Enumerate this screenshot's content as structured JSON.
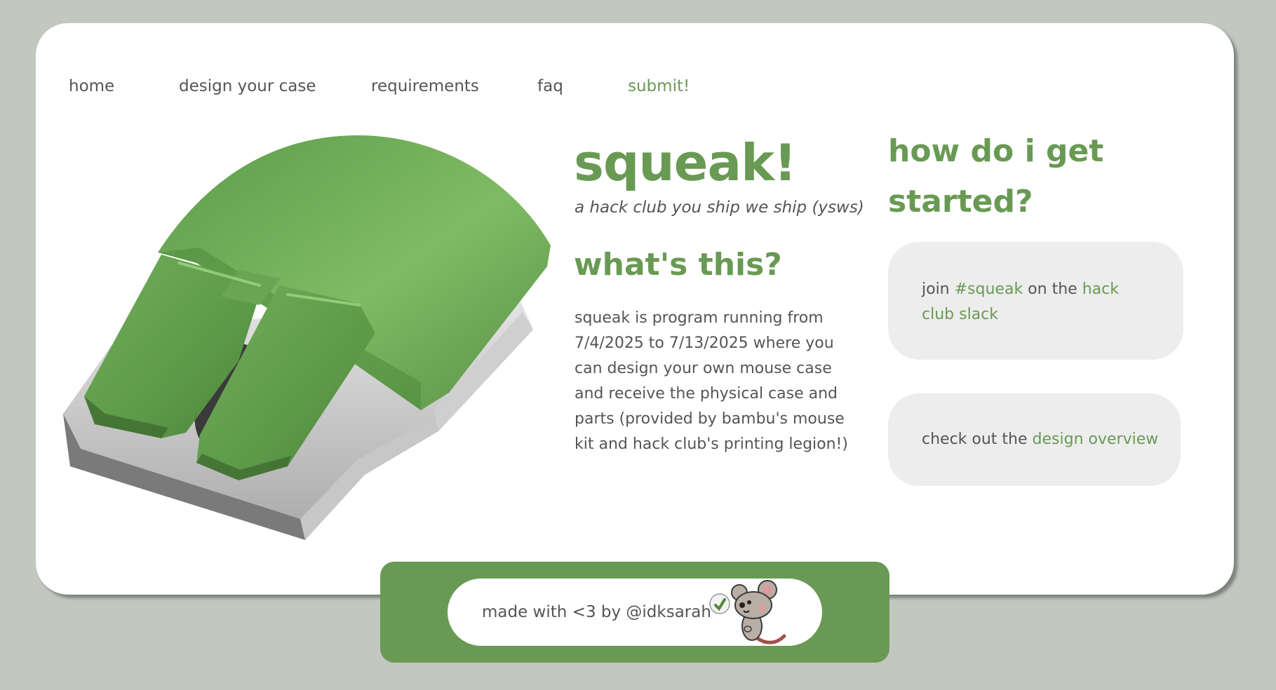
{
  "nav": {
    "home": "home",
    "design": "design your case",
    "requirements": "requirements",
    "faq": "faq",
    "submit": "submit!"
  },
  "hero": {
    "title": "squeak!",
    "subtitle": "a hack club you ship we ship (ysws)"
  },
  "about": {
    "heading": "what's this?",
    "body": "squeak is program running from 7/4/2025 to 7/13/2025 where you can design your own mouse case and receive the physical case and parts (provided by bambu's mouse kit and hack club's printing legion!)"
  },
  "started": {
    "heading": "how do i get started?",
    "step1": {
      "prefix": "join ",
      "channel": "#squeak",
      "middle": " on the ",
      "link": "hack club slack"
    },
    "step2": {
      "prefix": "check out the ",
      "link": "design overview"
    }
  },
  "footer": {
    "text": "made with <3 by @idksarah"
  },
  "colors": {
    "accent": "#699a53",
    "background": "#c2c8c0",
    "text": "#555555",
    "box": "#ededed"
  },
  "icons": {
    "hero_image": "mouse-case-render",
    "mascot": "rat-mascot-icon"
  }
}
